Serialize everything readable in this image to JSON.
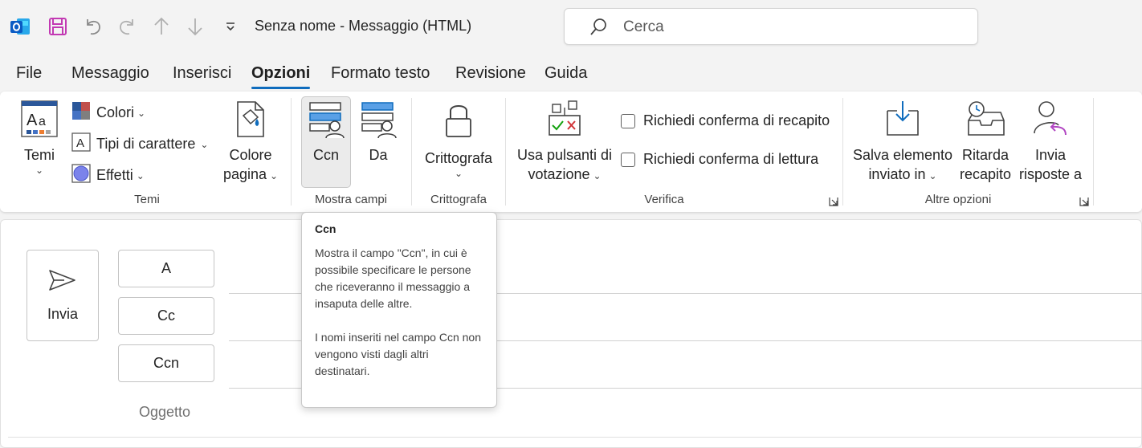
{
  "window": {
    "title": "Senza nome  -  Messaggio (HTML)"
  },
  "search": {
    "placeholder": "Cerca"
  },
  "tabs": [
    {
      "label": "File"
    },
    {
      "label": "Messaggio"
    },
    {
      "label": "Inserisci"
    },
    {
      "label": "Opzioni",
      "active": true
    },
    {
      "label": "Formato testo"
    },
    {
      "label": "Revisione"
    },
    {
      "label": "Guida"
    }
  ],
  "ribbon": {
    "themes": {
      "temi_label": "Temi",
      "colori_label": "Colori",
      "tipi_label": "Tipi di carattere",
      "effetti_label": "Effetti",
      "colore_pagina_line1": "Colore",
      "colore_pagina_line2": "pagina",
      "group_label": "Temi"
    },
    "fields": {
      "ccn_label": "Ccn",
      "da_label": "Da",
      "group_label": "Mostra campi"
    },
    "encrypt": {
      "label": "Crittografa",
      "group_label": "Crittografa"
    },
    "tracking": {
      "vote_line1": "Usa pulsanti di",
      "vote_line2": "votazione",
      "delivery_receipt": "Richiedi conferma di recapito",
      "read_receipt": "Richiedi conferma di lettura",
      "group_label": "Verifica"
    },
    "more": {
      "save_line1": "Salva elemento",
      "save_line2": "inviato in",
      "delay_line1": "Ritarda",
      "delay_line2": "recapito",
      "reply_line1": "Invia",
      "reply_line2": "risposte a",
      "group_label": "Altre opzioni"
    }
  },
  "compose": {
    "send_label": "Invia",
    "to_label": "A",
    "cc_label": "Cc",
    "bcc_label": "Ccn",
    "subject_label": "Oggetto"
  },
  "tooltip": {
    "title": "Ccn",
    "body1": "Mostra il campo \"Ccn\", in cui è possibile specificare le persone che riceveranno il messaggio a insaputa delle altre.",
    "body2": "I nomi inseriti nel campo Ccn non vengono visti dagli altri destinatari."
  },
  "colors": {
    "accent": "#0f6cbd",
    "outlook_blue": "#0a5bc4",
    "save_purple": "#c239b3"
  }
}
